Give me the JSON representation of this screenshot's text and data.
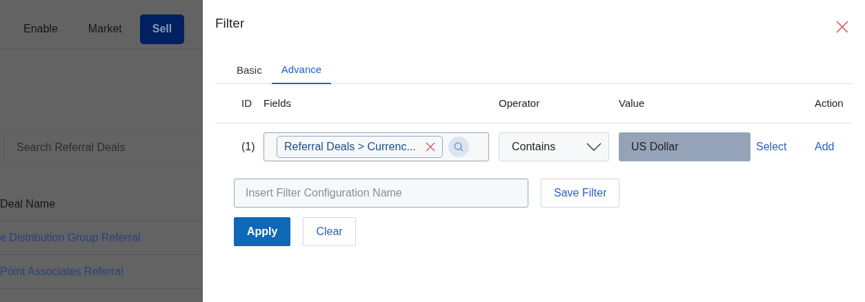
{
  "background": {
    "nav_tabs": [
      {
        "label": "Enable",
        "selected": false
      },
      {
        "label": "Market",
        "selected": false
      },
      {
        "label": "Sell",
        "selected": true
      }
    ],
    "search": {
      "placeholder": "Search Referral Deals"
    },
    "table": {
      "columns": [
        "Deal Name"
      ],
      "rows": [
        "e Distribution Group Referral",
        "Point Associates Referral"
      ]
    }
  },
  "drawer": {
    "title": "Filter",
    "tabs": [
      {
        "label": "Basic",
        "selected": false
      },
      {
        "label": "Advance",
        "selected": true
      }
    ],
    "columns": [
      "ID",
      "Fields",
      "Operator",
      "Value",
      "Action"
    ],
    "rows": [
      {
        "id": "(1)",
        "field_tag": "Referral Deals > Currenc...",
        "operator": "Contains",
        "value": "US Dollar",
        "value_disabled": true,
        "select_link": "Select",
        "action": "Add"
      }
    ],
    "config_name": {
      "placeholder": "Insert Filter Configuration Name"
    },
    "save_button": "Save Filter",
    "buttons": [
      {
        "label": "Apply",
        "kind": "primary"
      },
      {
        "label": "Clear",
        "kind": "outline"
      }
    ]
  }
}
